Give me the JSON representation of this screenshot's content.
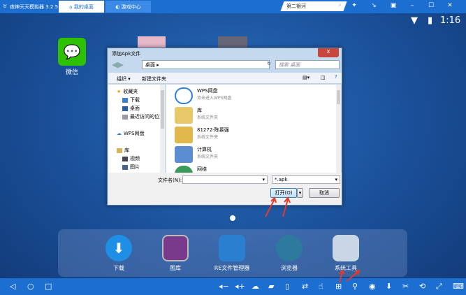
{
  "topbar": {
    "app_title": "夜神天天模拟器 3.2.5",
    "tabs": [
      {
        "label": "我的桌面"
      },
      {
        "label": "游戏中心"
      }
    ],
    "search_value": "第二银河"
  },
  "status": {
    "time": "1:16"
  },
  "desktop": {
    "apps": [
      {
        "label": "微信"
      }
    ]
  },
  "dialog": {
    "title": "添加Apk文件",
    "close": "x",
    "address": "桌面",
    "search_placeholder": "搜索 桌面",
    "organize": "组织 ▾",
    "new_folder": "新建文件夹",
    "nav": [
      {
        "label": "收藏夹"
      },
      {
        "label": "下载"
      },
      {
        "label": "桌面"
      },
      {
        "label": "最近访问的位置"
      },
      {
        "label": "WPS网盘"
      },
      {
        "label": "库"
      },
      {
        "label": "视频"
      },
      {
        "label": "图片"
      }
    ],
    "files": [
      {
        "name": "WPS网盘",
        "sub": "双击进入WPS网盘"
      },
      {
        "name": "库",
        "sub": "系统文件夹"
      },
      {
        "name": "81272-陈慕强",
        "sub": "系统文件夹"
      },
      {
        "name": "计算机",
        "sub": "系统文件夹"
      },
      {
        "name": "网络",
        "sub": ""
      }
    ],
    "filename_label": "文件名(N):",
    "filename_value": "",
    "filter": "*.apk",
    "open": "打开(O)",
    "cancel": "取消"
  },
  "dock": [
    {
      "label": "下载",
      "color": "#1f8fe6"
    },
    {
      "label": "图库",
      "color": "#7a3a8c"
    },
    {
      "label": "RE文件管理器",
      "color": "#2b7fd0"
    },
    {
      "label": "浏览器",
      "color": "#2e7a9e"
    },
    {
      "label": "系统工具",
      "color": "#c8d6e6"
    }
  ],
  "annotation_color": "#e53a2a"
}
